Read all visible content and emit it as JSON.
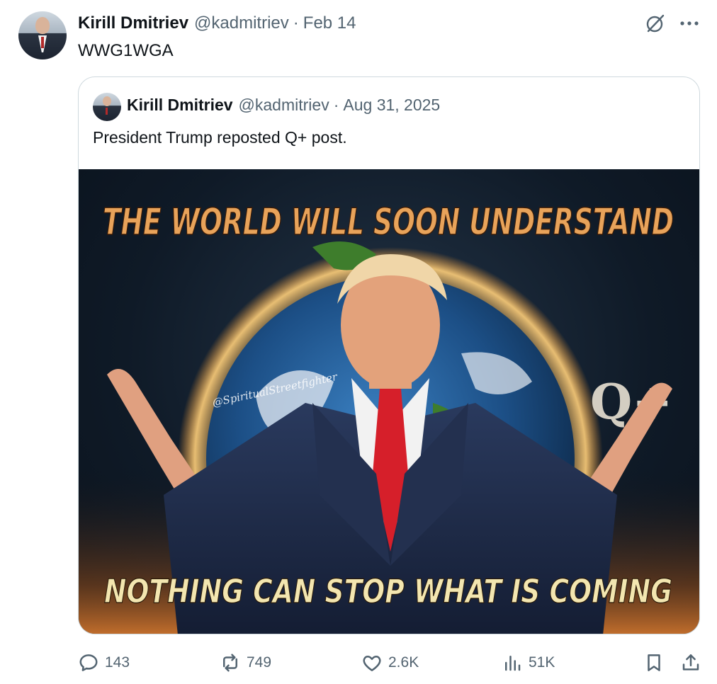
{
  "post": {
    "author_name": "Kirill Dmitriev",
    "handle": "@kadmitriev",
    "separator": "·",
    "date": "Feb 14",
    "text": "WWG1WGA",
    "icons": [
      "grok-icon",
      "more-icon"
    ]
  },
  "quoted": {
    "author_name": "Kirill Dmitriev",
    "handle": "@kadmitriev",
    "separator": "·",
    "date": "Aug 31, 2025",
    "text": "President Trump reposted Q+ post.",
    "image": {
      "headline_top": "THE WORLD WILL SOON UNDERSTAND",
      "headline_bottom": "NOTHING CAN STOP WHAT IS COMING",
      "watermark": "@SpiritualStreetfighter",
      "symbol": "Q+"
    }
  },
  "actions": {
    "replies": "143",
    "reposts": "749",
    "likes": "2.6K",
    "views": "51K"
  },
  "colors": {
    "text_primary": "#0f1419",
    "text_secondary": "#536471",
    "border": "#cfd9de",
    "headline_top": "#e8a35a",
    "headline_bottom": "#f3e6b0",
    "tie_red": "#d61f2a",
    "suit_navy": "#1e2a45"
  }
}
